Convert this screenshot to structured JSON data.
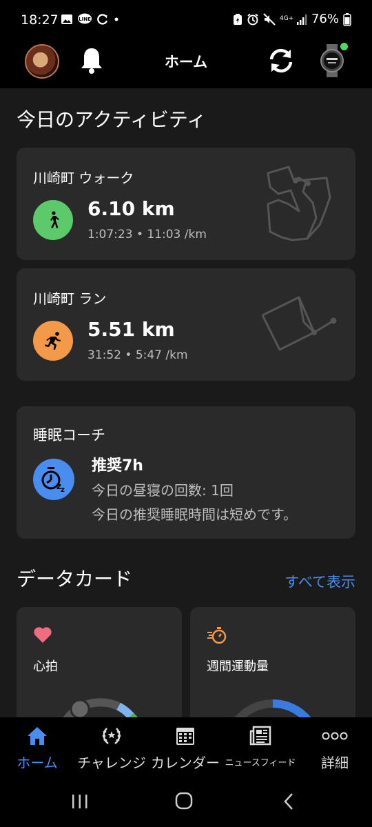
{
  "status_bar": {
    "time": "18:27",
    "battery": "76%",
    "network": "4G+"
  },
  "header": {
    "title": "ホーム"
  },
  "today": {
    "title": "今日のアクティビティ",
    "activities": [
      {
        "name": "川崎町 ウォーク",
        "distance": "6.10 km",
        "stats": "1:07:23 • 11:03 /km",
        "type": "walk",
        "color": "#5cc96b"
      },
      {
        "name": "川崎町 ラン",
        "distance": "5.51 km",
        "stats": "31:52 • 5:47 /km",
        "type": "run",
        "color": "#f2994a"
      }
    ]
  },
  "sleep_coach": {
    "title": "睡眠コーチ",
    "recommended": "推奨7h",
    "line1": "今日の昼寝の回数: 1回",
    "line2": "今日の推奨睡眠時間は短めです。",
    "color": "#4a8df0"
  },
  "data_cards": {
    "title": "データカード",
    "show_all": "すべて表示",
    "items": [
      {
        "label": "心拍",
        "icon": "heart-icon"
      },
      {
        "label": "週間運動量",
        "icon": "stopwatch-icon"
      }
    ]
  },
  "bottom_nav": {
    "items": [
      {
        "label": "ホーム",
        "icon": "home-icon",
        "active": true
      },
      {
        "label": "チャレンジ",
        "icon": "laurel-icon"
      },
      {
        "label": "カレンダー",
        "icon": "calendar-icon"
      },
      {
        "label": "ニュースフィード",
        "icon": "newsfeed-icon"
      },
      {
        "label": "詳細",
        "icon": "more-icon"
      }
    ]
  },
  "colors": {
    "accent": "#4a8df0",
    "background": "#1a1a1a",
    "card": "#2a2a2a"
  }
}
